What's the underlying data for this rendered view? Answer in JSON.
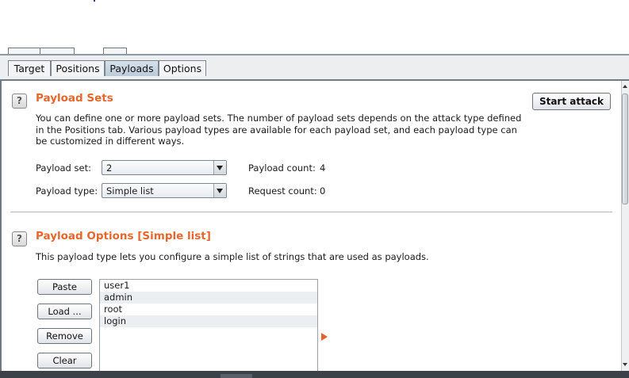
{
  "tabs": [
    {
      "label": "Target"
    },
    {
      "label": "Positions"
    },
    {
      "label": "Payloads"
    },
    {
      "label": "Options"
    }
  ],
  "active_tab": "Payloads",
  "help_icon_glyph": "?",
  "payload_sets": {
    "title": "Payload Sets",
    "description": [
      "You can define one or more payload sets. The number of payload sets depends on the attack type defined",
      "in the Positions tab. Various payload types are available for each payload set, and each payload type can",
      "be customized in different ways."
    ],
    "start_attack_label": "Start attack",
    "payload_set_label": "Payload set:",
    "payload_set_value": "2",
    "payload_type_label": "Payload type:",
    "payload_type_value": "Simple list",
    "payload_count_label": "Payload count:",
    "payload_count_value": "4",
    "request_count_label": "Request count:",
    "request_count_value": "0"
  },
  "payload_options": {
    "title": "Payload Options [Simple list]",
    "description": "This payload type lets you configure a simple list of strings that are used as payloads.",
    "buttons": {
      "paste": "Paste",
      "load": "Load ...",
      "remove": "Remove",
      "clear": "Clear"
    },
    "list_items": [
      "user1",
      "admin",
      "root",
      "login"
    ]
  },
  "colors": {
    "section_title": "#e5672d",
    "active_tab": "#c8d5e2",
    "arrow": "#e8602a"
  },
  "icons": [
    "help-icon",
    "combo-arrow-icon",
    "orange-arrow-icon",
    "scroll-up-icon",
    "scroll-down-icon"
  ]
}
